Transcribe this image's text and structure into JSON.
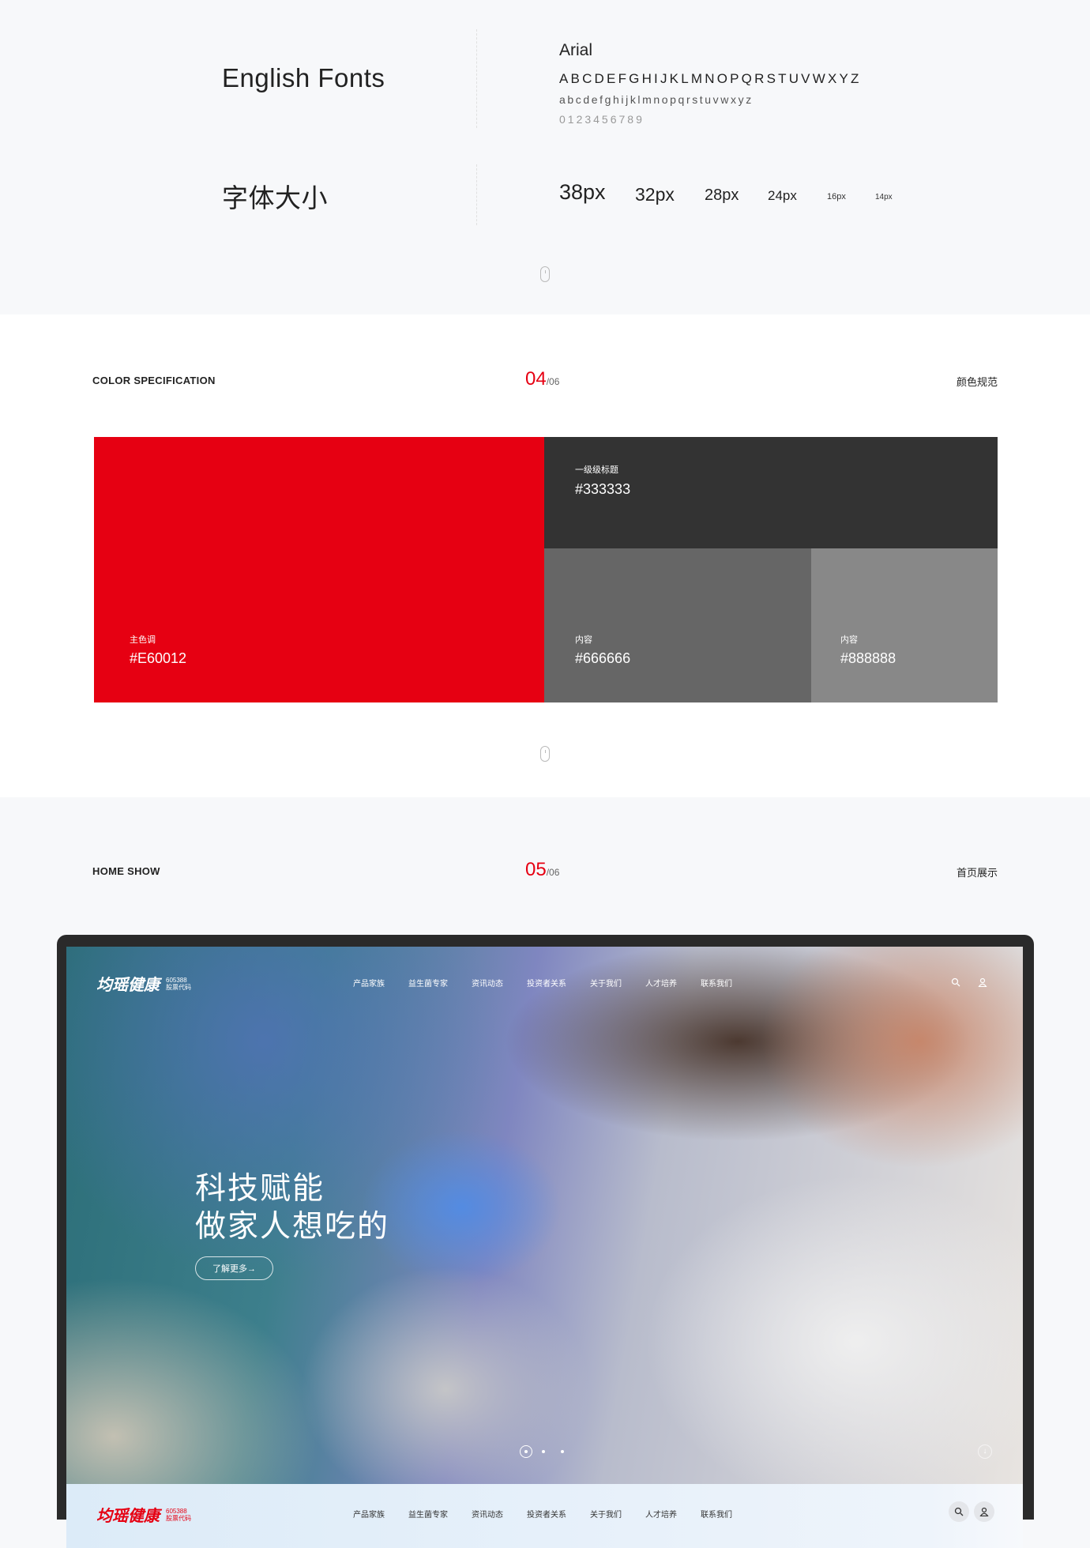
{
  "fonts": {
    "title": "English Fonts",
    "font_name": "Arial",
    "uppercase": "ABCDEFGHIJKLMNOPQRSTUVWXYZ",
    "lowercase": "abcdefghijklmnopqrstuvwxyz",
    "digits": "0123456789",
    "size_title": "字体大小",
    "sizes": [
      "38px",
      "32px",
      "28px",
      "24px",
      "16px",
      "14px"
    ]
  },
  "color_section": {
    "label": "COLOR SPECIFICATION",
    "num": "04",
    "total": "/06",
    "right": "颜色规范",
    "swatches": [
      {
        "caption": "主色调",
        "hex": "#E60012",
        "color": "#e60012"
      },
      {
        "caption": "一级级标题",
        "hex": "#333333",
        "color": "#333333"
      },
      {
        "caption": "内容",
        "hex": "#666666",
        "color": "#666666"
      },
      {
        "caption": "内容",
        "hex": "#888888",
        "color": "#888888"
      }
    ]
  },
  "home_section": {
    "label": "HOME SHOW",
    "num": "05",
    "total": "/06",
    "right": "首页展示"
  },
  "site": {
    "logo": "均瑶健康",
    "stock_code": "605388",
    "stock_label": "股票代码",
    "menu": [
      "产品家族",
      "益生菌专家",
      "资讯动态",
      "投资者关系",
      "关于我们",
      "人才培养",
      "联系我们"
    ],
    "hero_line1": "科技赋能",
    "hero_line2": "做家人想吃的",
    "more_button": "了解更多→",
    "carousel_slides": 3,
    "carousel_active": 1
  },
  "accent": "#e60012"
}
